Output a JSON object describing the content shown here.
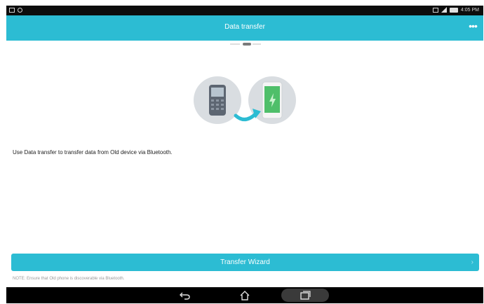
{
  "colors": {
    "accent": "#2cbcd3",
    "status_bar": "#0d0d0d",
    "nav_bar": "#000000"
  },
  "status_bar": {
    "time": "4:05 PM",
    "icons": [
      "notification-icon",
      "signal-icon",
      "battery-icon"
    ]
  },
  "app_bar": {
    "title": "Data transfer",
    "menu_icon": "more-icon"
  },
  "illustration": {
    "icons": [
      "old-phone-icon",
      "transfer-arrow-icon",
      "new-phone-icon"
    ]
  },
  "main": {
    "description": "Use Data transfer to transfer data from Old device via Bluetooth."
  },
  "wizard": {
    "label": "Transfer Wizard",
    "chevron": "›"
  },
  "note": "NOTE: Ensure that Old phone is discoverable via Bluetooth.",
  "nav_bar": {
    "icons": [
      "back-icon",
      "home-icon",
      "recent-apps-icon"
    ]
  }
}
